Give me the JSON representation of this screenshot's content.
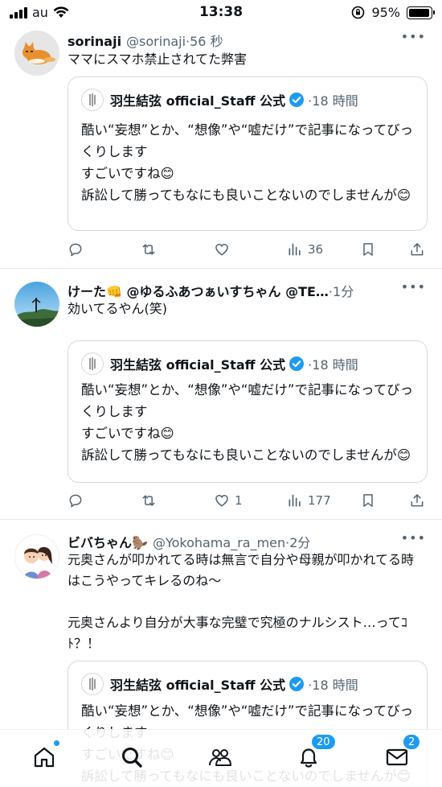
{
  "status_bar": {
    "carrier": "au",
    "time": "13:38",
    "battery": "95%",
    "battery_level": 0.95
  },
  "tweets": [
    {
      "name": "sorinaji",
      "handle": "@sorinaji",
      "time": "·56 秒",
      "text": "ママにスマホ禁止されてた弊害",
      "avatar_icon": "fox-avatar",
      "actions": {
        "reply": "",
        "retweet": "",
        "like": "",
        "views": "36"
      }
    },
    {
      "name": "けーた👊 @ゆるふあつぁいすちゃん @TE…",
      "handle": "",
      "time": "·1分",
      "text": "効いてるやん(笑)",
      "avatar_icon": "landscape-avatar",
      "actions": {
        "reply": "",
        "retweet": "",
        "like": "1",
        "views": "177"
      }
    },
    {
      "name": "ビバちゃん🦫",
      "handle": "@Yokohama_ra_men",
      "time": "·2分",
      "text": "元奥さんが叩かれてる時は無言で自分や母親が叩かれてる時はこうやってキレるのね〜\n\n元奥さんより自分が大事な完璧で究極のナルシスト…ってｺﾄ？！",
      "avatar_icon": "couple-avatar",
      "actions": {}
    }
  ],
  "quoted": {
    "name": "羽生結弦 official_Staff 公式",
    "time": "·18 時間",
    "text": "酷い“妄想”とか、“想像”や“嘘だけ”で記事になってびっくりします\nすごいですね😊\n訴訟して勝ってもなにも良いことないのでしませんが😊"
  },
  "nav": {
    "items": [
      "home-icon",
      "search-icon",
      "communities-icon",
      "notifications-icon",
      "messages-icon"
    ],
    "notifications_badge": "20",
    "messages_badge": "2"
  },
  "colors": {
    "accent": "#1d9bf0",
    "secondary_text": "#536471",
    "border": "#cfd9de"
  }
}
